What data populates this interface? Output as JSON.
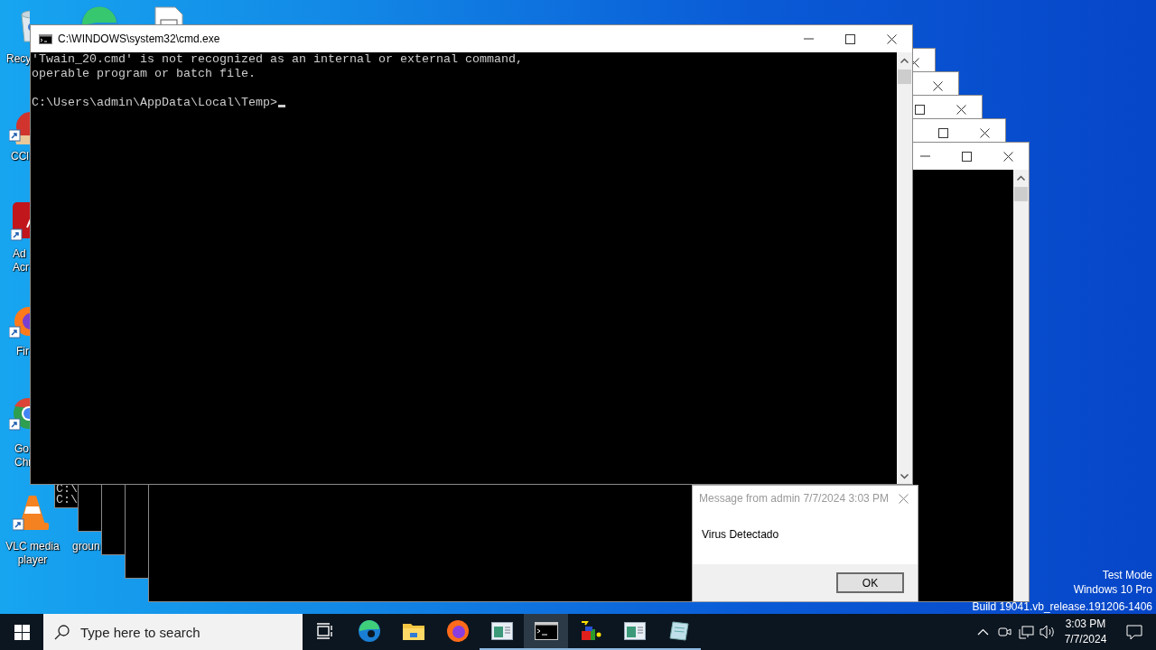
{
  "desktop": {
    "icons": [
      {
        "kind": "recycle-bin",
        "label_lines": [
          "Recy"
        ]
      },
      {
        "kind": "edge"
      },
      {
        "kind": "document"
      },
      {
        "kind": "ccleaner",
        "label_lines": [
          "CCl"
        ]
      },
      {
        "kind": "acrobat",
        "label_lines": [
          "Ad",
          "Acr"
        ]
      },
      {
        "kind": "firefox",
        "label_lines": [
          "Fir"
        ]
      },
      {
        "kind": "chrome",
        "label_lines": [
          "Go",
          "Chr"
        ]
      },
      {
        "kind": "vlc",
        "label_lines": [
          "VLC media",
          "player"
        ]
      },
      {
        "kind": "hidden",
        "label_lines": [
          "groun"
        ]
      }
    ],
    "system_lines": [
      "Test Mode",
      "Windows 10 Pro",
      "Build 19041.vb_release.191206-1406"
    ]
  },
  "background_windows": [
    {
      "kind": "console",
      "lines": [
        "C:\\",
        "C:\\"
      ]
    },
    {
      "kind": "console"
    },
    {
      "kind": "console"
    },
    {
      "kind": "console"
    },
    {
      "kind": "console"
    }
  ],
  "main_window": {
    "title": "C:\\WINDOWS\\system32\\cmd.exe",
    "output_lines": [
      "'Twain_20.cmd' is not recognized as an internal or external command,",
      "operable program or batch file."
    ],
    "prompt": "C:\\Users\\admin\\AppData\\Local\\Temp>"
  },
  "message_box": {
    "title": "Message from admin 7/7/2024 3:03 PM",
    "text": "Virus Detectado",
    "button": "OK"
  },
  "taskbar": {
    "search": {
      "placeholder": "Type here to search"
    },
    "apps": [
      {
        "kind": "task-view",
        "running": false,
        "selected": false
      },
      {
        "kind": "edge",
        "running": false,
        "selected": false
      },
      {
        "kind": "explorer",
        "running": false,
        "selected": false
      },
      {
        "kind": "firefox",
        "running": false,
        "selected": false
      },
      {
        "kind": "window-app",
        "running": true,
        "selected": false
      },
      {
        "kind": "cmd",
        "running": true,
        "selected": true
      },
      {
        "kind": "blocks",
        "running": true,
        "selected": false
      },
      {
        "kind": "window-app",
        "running": true,
        "selected": false
      },
      {
        "kind": "notepad",
        "running": true,
        "selected": false
      }
    ],
    "clock": {
      "time": "3:03 PM",
      "date": "7/7/2024"
    }
  }
}
